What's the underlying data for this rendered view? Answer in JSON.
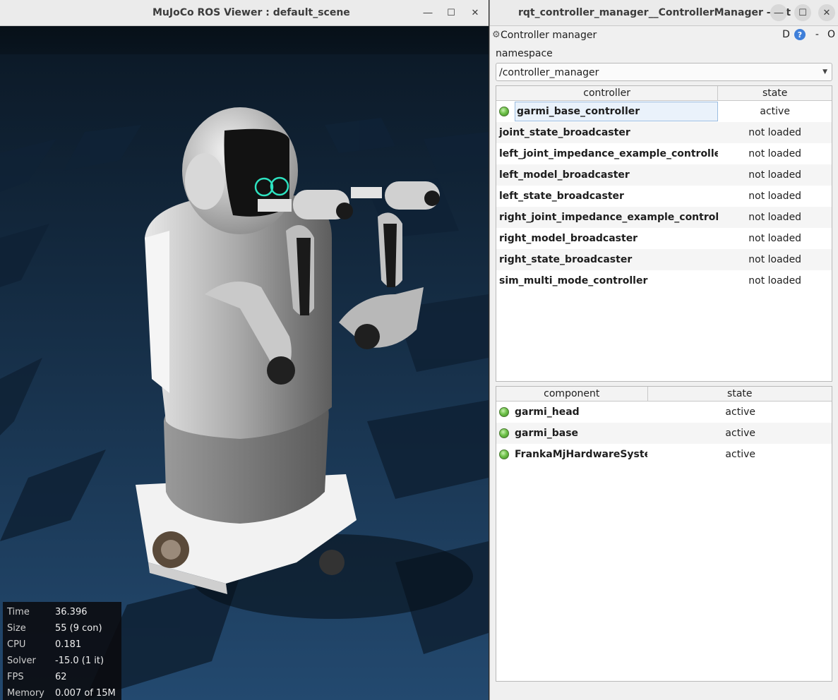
{
  "mujoco": {
    "title": "MuJoCo ROS Viewer : default_scene",
    "info": [
      {
        "label": "Time",
        "value": "36.396"
      },
      {
        "label": "Size",
        "value": "55  (9 con)"
      },
      {
        "label": "CPU",
        "value": "0.181"
      },
      {
        "label": "Solver",
        "value": "-15.0  (1 it)"
      },
      {
        "label": "FPS",
        "value": "62"
      },
      {
        "label": "Memory",
        "value": "0.007 of 15M"
      }
    ]
  },
  "rqt": {
    "title": "rqt_controller_manager__ControllerManager - rqt",
    "plugin_title": "Controller manager",
    "plugin_ctrls": {
      "d": "D",
      "dash": "-",
      "o": "O"
    },
    "namespace_label": "namespace",
    "namespace_value": "/controller_manager",
    "controllers_header": {
      "name": "controller",
      "state": "state"
    },
    "controllers": [
      {
        "name": "garmi_base_controller",
        "state": "active"
      },
      {
        "name": "joint_state_broadcaster",
        "state": "not loaded"
      },
      {
        "name": "left_joint_impedance_example_controller",
        "state": "not loaded"
      },
      {
        "name": "left_model_broadcaster",
        "state": "not loaded"
      },
      {
        "name": "left_state_broadcaster",
        "state": "not loaded"
      },
      {
        "name": "right_joint_impedance_example_controller",
        "state": "not loaded"
      },
      {
        "name": "right_model_broadcaster",
        "state": "not loaded"
      },
      {
        "name": "right_state_broadcaster",
        "state": "not loaded"
      },
      {
        "name": "sim_multi_mode_controller",
        "state": "not loaded"
      }
    ],
    "components_header": {
      "name": "component",
      "state": "state"
    },
    "components": [
      {
        "name": "garmi_head",
        "state": "active"
      },
      {
        "name": "garmi_base",
        "state": "active"
      },
      {
        "name": "FrankaMjHardwareSystem",
        "state": "active"
      }
    ]
  },
  "icons": {
    "minimize": "minimize-icon",
    "maximize": "maximize-icon",
    "close": "close-icon",
    "help": "help-icon",
    "status_led": "status-led-icon"
  }
}
